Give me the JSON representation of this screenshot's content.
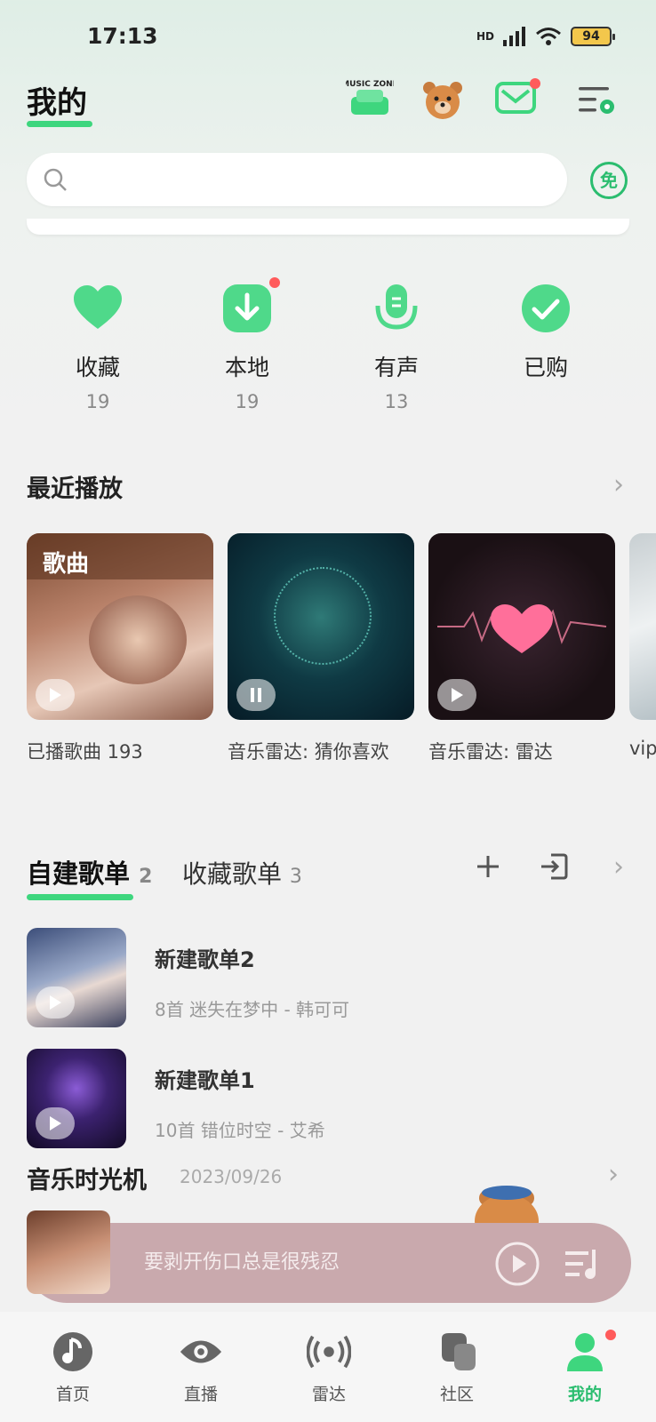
{
  "status_bar": {
    "time": "17:13",
    "network": "HD",
    "battery": "94"
  },
  "header": {
    "title": "我的",
    "music_zone_label": "MUSIC ZONE"
  },
  "search": {
    "placeholder": "",
    "free_badge": "免"
  },
  "quick_actions": [
    {
      "label": "收藏",
      "count": "19",
      "icon": "heart-icon"
    },
    {
      "label": "本地",
      "count": "19",
      "icon": "download-icon"
    },
    {
      "label": "有声",
      "count": "13",
      "icon": "microphone-icon"
    },
    {
      "label": "已购",
      "count": "",
      "icon": "check-icon"
    }
  ],
  "recent": {
    "title": "最近播放",
    "cards": [
      {
        "label": "已播歌曲 193",
        "overlay": "歌曲"
      },
      {
        "label": "音乐雷达: 猜你喜欢"
      },
      {
        "label": "音乐雷达: 雷达"
      },
      {
        "label": "vip"
      }
    ]
  },
  "playlists_tabs": {
    "active": {
      "label": "自建歌单",
      "count": "2"
    },
    "inactive": {
      "label": "收藏歌单",
      "count": "3"
    }
  },
  "playlists": [
    {
      "name": "新建歌单2",
      "sub": "8首 迷失在梦中 - 韩可可"
    },
    {
      "name": "新建歌单1",
      "sub": "10首 错位时空 - 艾希"
    }
  ],
  "time_machine": {
    "title": "音乐时光机",
    "date": "2023/09/26"
  },
  "mini_player": {
    "text": "要剥开伤口总是很残忍"
  },
  "bottom_nav": [
    {
      "label": "首页",
      "icon": "music-note-icon"
    },
    {
      "label": "直播",
      "icon": "eye-icon"
    },
    {
      "label": "雷达",
      "icon": "radar-icon"
    },
    {
      "label": "社区",
      "icon": "community-icon"
    },
    {
      "label": "我的",
      "icon": "profile-icon"
    }
  ],
  "colors": {
    "accent": "#3ed67e",
    "badge_red": "#ff5b5b",
    "player_bg": "#c9a9ad"
  }
}
